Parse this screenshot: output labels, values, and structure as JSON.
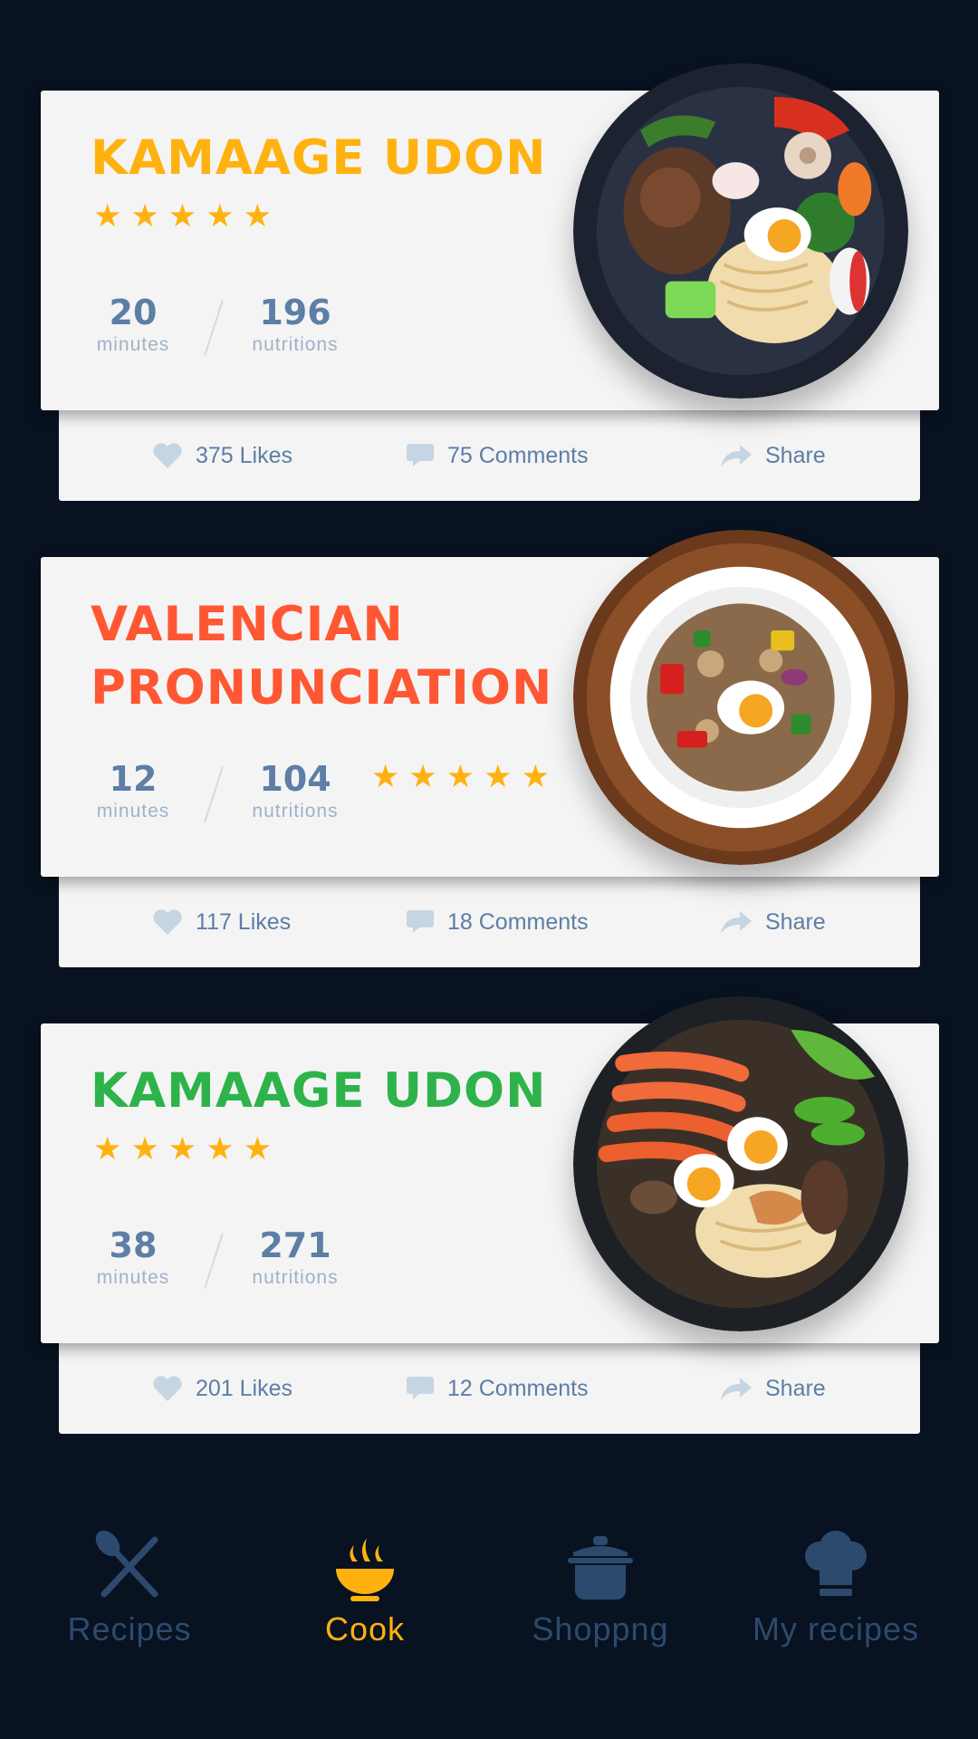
{
  "recipes": [
    {
      "title": "KAMAAGE UDON",
      "title_color": "#ffb20f",
      "rating": 5,
      "minutes": "20",
      "minutes_label": "minutes",
      "nutritions": "196",
      "nutritions_label": "nutritions",
      "likes": "375 Likes",
      "comments": "75 Comments",
      "share": "Share",
      "dish_icon": "udon-bowl-image"
    },
    {
      "title": "VALENCIAN\nPRONUNCIATION",
      "title_color": "#ff5733",
      "rating": 5,
      "minutes": "12",
      "minutes_label": "minutes",
      "nutritions": "104",
      "nutritions_label": "nutritions",
      "likes": "117 Likes",
      "comments": "18 Comments",
      "share": "Share",
      "dish_icon": "rice-bowl-image"
    },
    {
      "title": "KAMAAGE UDON",
      "title_color": "#2db34a",
      "rating": 5,
      "minutes": "38",
      "minutes_label": "minutes",
      "nutritions": "271",
      "nutritions_label": "nutritions",
      "likes": "201 Likes",
      "comments": "12 Comments",
      "share": "Share",
      "dish_icon": "shrimp-ramen-image"
    }
  ],
  "tabs": [
    {
      "label": "Recipes",
      "icon": "fork-knife-icon",
      "active": false
    },
    {
      "label": "Cook",
      "icon": "cooking-pan-icon",
      "active": true
    },
    {
      "label": "Shoppng",
      "icon": "pot-icon",
      "active": false
    },
    {
      "label": "My recipes",
      "icon": "chef-hat-icon",
      "active": false
    }
  ],
  "colors": {
    "background": "#081220",
    "card": "#f4f4f4",
    "stat_value": "#5d7ea5",
    "stat_label": "#9fb2c8",
    "star": "#ffb20f",
    "tab_inactive": "#2c4a6e",
    "tab_active": "#ffb20f"
  }
}
